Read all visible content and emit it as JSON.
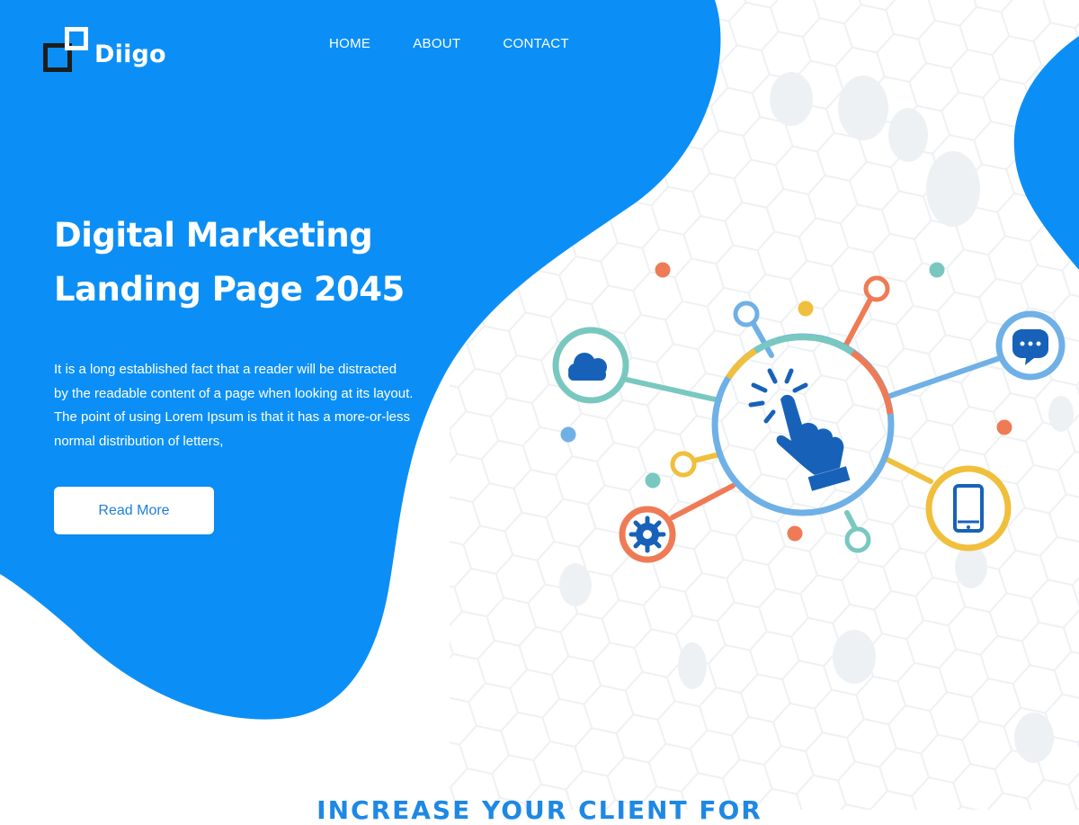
{
  "brand": {
    "name": "Diigo"
  },
  "nav": {
    "items": [
      {
        "label": "HOME"
      },
      {
        "label": "ABOUT"
      },
      {
        "label": "CONTACT"
      }
    ]
  },
  "hero": {
    "title_line1": "Digital Marketing",
    "title_line2": "Landing Page 2045",
    "body": "It is a long established fact that a reader will be distracted by the readable content of a page when looking at its layout. The point of using Lorem Ipsum is that it has a more-or-less normal distribution of letters,",
    "button_label": "Read More"
  },
  "section": {
    "heading": "INCREASE YOUR CLIENT FOR"
  },
  "illustration": {
    "icons": [
      "cloud-icon",
      "chat-icon",
      "smartphone-icon",
      "gear-icon",
      "pointer-hand-icon"
    ],
    "colors": {
      "teal": "#78c8c0",
      "blue": "#6fb0e6",
      "orange": "#ee7b55",
      "yellow": "#f0bf3c",
      "dark_blue": "#1762b8"
    }
  },
  "theme": {
    "primary": "#0b8ff6",
    "accent_text": "#1d7fdc",
    "heading_blue": "#1e88e5"
  }
}
